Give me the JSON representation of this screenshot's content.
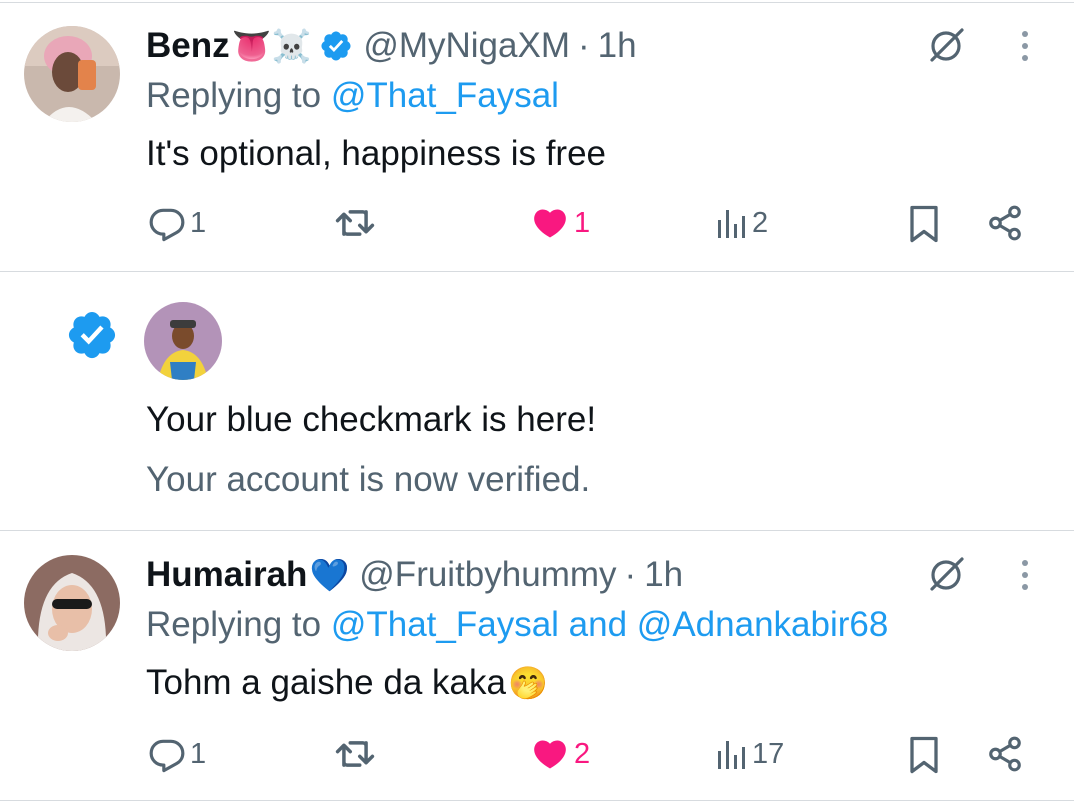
{
  "colors": {
    "accent": "#1d9bf0",
    "like": "#f91880",
    "secondary_text": "#536471",
    "primary_text": "#0f1419",
    "divider": "#d7dbdf"
  },
  "tweets": [
    {
      "display_name": "Benz",
      "name_emojis": "👅☠️",
      "verified": true,
      "handle": "@MyNigaXM",
      "separator": "·",
      "time": "1h",
      "replying_prefix": "Replying to",
      "replying_to": "@That_Faysal",
      "text": "It's optional, happiness is free",
      "replies": "1",
      "likes": "1",
      "views": "2",
      "liked": true
    },
    {
      "display_name": "Humairah",
      "name_emojis": "💙",
      "verified": false,
      "handle": "@Fruitbyhummy",
      "separator": "·",
      "time": "1h",
      "replying_prefix": "Replying to",
      "replying_to": "@That_Faysal and @Adnankabir68",
      "text": "Tohm a gaishe da kaka",
      "text_emoji": "🤭",
      "replies": "1",
      "likes": "2",
      "views": "17",
      "liked": true
    }
  ],
  "notification": {
    "title": "Your blue checkmark is here!",
    "subtitle": "Your account is now verified."
  },
  "icons": {
    "verified": "verified-badge-icon",
    "grok": "grok-icon",
    "more": "more-vertical-icon",
    "reply": "reply-icon",
    "retweet": "retweet-icon",
    "like": "heart-filled-icon",
    "views": "views-chart-icon",
    "bookmark": "bookmark-icon",
    "share": "share-icon"
  }
}
